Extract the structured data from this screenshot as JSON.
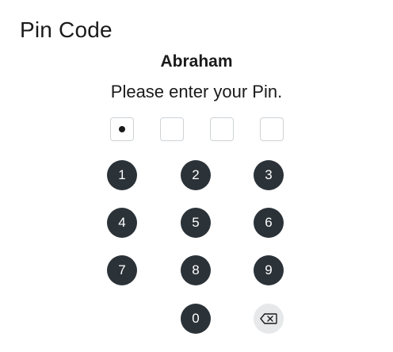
{
  "header": {
    "title": "Pin Code"
  },
  "user": {
    "name": "Abraham"
  },
  "prompt": "Please enter your Pin.",
  "pin": {
    "length": 4,
    "entered": 1
  },
  "keypad": {
    "keys": [
      "1",
      "2",
      "3",
      "4",
      "5",
      "6",
      "7",
      "8",
      "9",
      "0"
    ],
    "delete_icon": "backspace-icon"
  },
  "colors": {
    "key_background": "#2b3238",
    "key_text": "#ffffff",
    "delete_background": "#e6e8ea",
    "box_border": "#cfd3d7"
  }
}
